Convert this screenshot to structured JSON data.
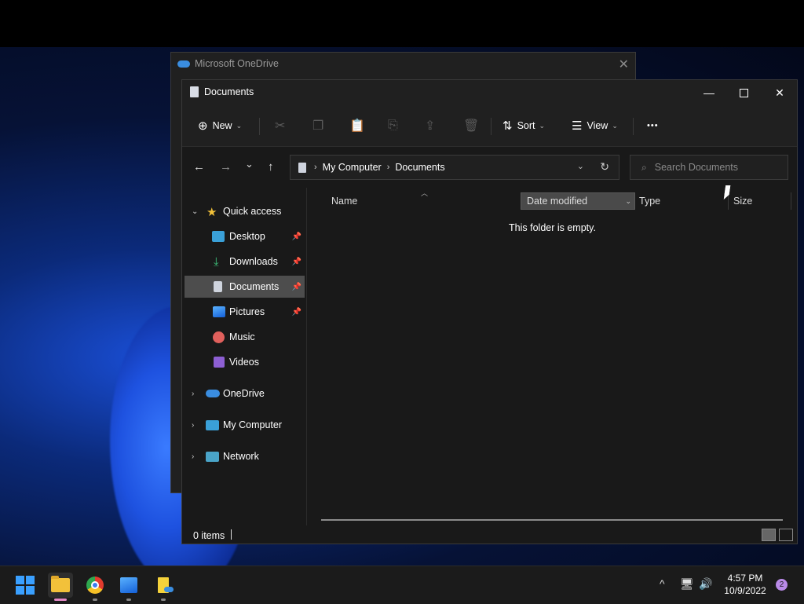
{
  "background_window": {
    "title": "Microsoft OneDrive",
    "close": "✕"
  },
  "window": {
    "title": "Documents",
    "controls": {
      "minimize": "—",
      "close": "✕"
    }
  },
  "toolbar": {
    "new_label": "New",
    "sort_label": "Sort",
    "view_label": "View",
    "more": "•••",
    "icons": [
      "cut-icon",
      "copy-icon",
      "paste-icon",
      "rename-icon",
      "share-icon",
      "delete-icon"
    ]
  },
  "navigation": {
    "back": "←",
    "forward": "→",
    "recent": "⌄",
    "up": "↑",
    "breadcrumb": [
      "My Computer",
      "Documents"
    ],
    "search_placeholder": "Search Documents"
  },
  "sidebar": {
    "quick_access": "Quick access",
    "items": [
      {
        "label": "Desktop",
        "pinned": true
      },
      {
        "label": "Downloads",
        "pinned": true
      },
      {
        "label": "Documents",
        "pinned": true,
        "selected": true
      },
      {
        "label": "Pictures",
        "pinned": true
      },
      {
        "label": "Music",
        "pinned": false
      },
      {
        "label": "Videos",
        "pinned": false
      }
    ],
    "roots": [
      "OneDrive",
      "My Computer",
      "Network"
    ]
  },
  "columns": {
    "name": "Name",
    "date": "Date modified",
    "type": "Type",
    "size": "Size"
  },
  "content": {
    "empty_message": "This folder is empty."
  },
  "status": {
    "items": "0 items"
  },
  "taskbar": {
    "time": "4:57 PM",
    "date": "10/9/2022",
    "notifications": "2",
    "tray": {
      "chevron": "^",
      "volume": "🔊"
    }
  },
  "colors": {
    "selected": "#4d4d4d",
    "accent": "#3aa0ff",
    "window_bg": "#191919",
    "toolbar_bg": "#202020"
  }
}
